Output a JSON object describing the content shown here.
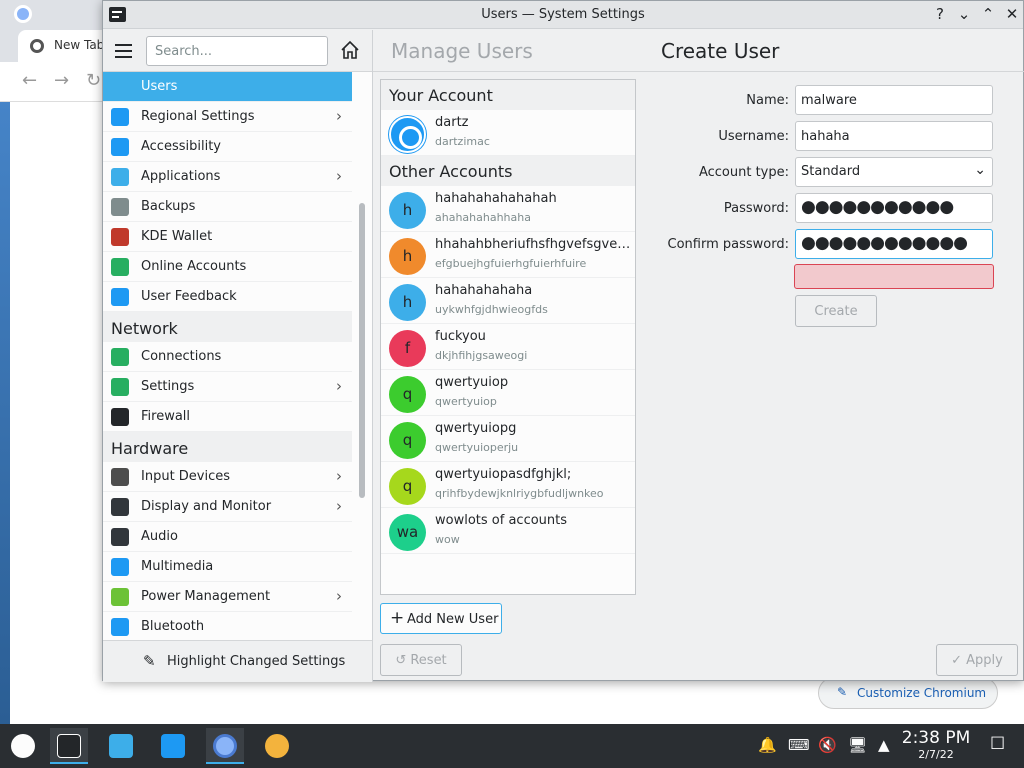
{
  "window": {
    "title": "Users — System Settings"
  },
  "sidebar": {
    "search_placeholder": "Search...",
    "items": [
      {
        "label": "Users",
        "icon": "users-icon",
        "color": "#3daee9",
        "selected": true,
        "chevron": false
      },
      {
        "label": "Regional Settings",
        "icon": "regional-settings-icon",
        "color": "#1d99f3",
        "chevron": true
      },
      {
        "label": "Accessibility",
        "icon": "accessibility-icon",
        "color": "#1d99f3",
        "chevron": false
      },
      {
        "label": "Applications",
        "icon": "applications-icon",
        "color": "#3daee9",
        "chevron": true
      },
      {
        "label": "Backups",
        "icon": "backups-icon",
        "color": "#7f8c8d",
        "chevron": false
      },
      {
        "label": "KDE Wallet",
        "icon": "kde-wallet-icon",
        "color": "#c0392b",
        "chevron": false
      },
      {
        "label": "Online Accounts",
        "icon": "online-accounts-icon",
        "color": "#27ae60",
        "chevron": false
      },
      {
        "label": "User Feedback",
        "icon": "user-feedback-icon",
        "color": "#1d99f3",
        "chevron": false
      }
    ],
    "section_network": "Network",
    "network_items": [
      {
        "label": "Connections",
        "icon": "connections-icon",
        "color": "#27ae60",
        "chevron": false
      },
      {
        "label": "Settings",
        "icon": "network-settings-icon",
        "color": "#27ae60",
        "chevron": true
      },
      {
        "label": "Firewall",
        "icon": "firewall-icon",
        "color": "#232629",
        "chevron": false
      }
    ],
    "section_hardware": "Hardware",
    "hardware_items": [
      {
        "label": "Input Devices",
        "icon": "input-devices-icon",
        "color": "#4d4d4d",
        "chevron": true
      },
      {
        "label": "Display and Monitor",
        "icon": "display-monitor-icon",
        "color": "#31363b",
        "chevron": true
      },
      {
        "label": "Audio",
        "icon": "audio-icon",
        "color": "#31363b",
        "chevron": false
      },
      {
        "label": "Multimedia",
        "icon": "multimedia-icon",
        "color": "#1d99f3",
        "chevron": false
      },
      {
        "label": "Power Management",
        "icon": "power-management-icon",
        "color": "#6cc236",
        "chevron": true
      },
      {
        "label": "Bluetooth",
        "icon": "bluetooth-icon",
        "color": "#1d99f3",
        "chevron": false
      }
    ],
    "footer_label": "Highlight Changed Settings"
  },
  "header": {
    "breadcrumb_prev": "Manage Users",
    "breadcrumb_current": "Create User"
  },
  "accounts": {
    "your_account_heading": "Your Account",
    "me": {
      "name": "dartz",
      "sub": "dartzimac"
    },
    "other_heading": "Other Accounts",
    "others": [
      {
        "initial": "h",
        "name": "hahahahahahahah",
        "sub": "ahahahahahhaha",
        "color": "#3daee9"
      },
      {
        "initial": "h",
        "name": "hhahahbheriufhsfhgvefsgveh...",
        "sub": "efgbuejhgfuierhgfuierhfuire",
        "color": "#f08a2c"
      },
      {
        "initial": "h",
        "name": "hahahahahaha",
        "sub": "uykwhfgjdhwieogfds",
        "color": "#3daee9"
      },
      {
        "initial": "f",
        "name": "fuckyou",
        "sub": "dkjhfihjgsaweogi",
        "color": "#e93a5a"
      },
      {
        "initial": "q",
        "name": "qwertyuiop",
        "sub": "qwertyuiop",
        "color": "#3ccc2e"
      },
      {
        "initial": "q",
        "name": "qwertyuiopg",
        "sub": "qwertyuioperju",
        "color": "#3ccc2e"
      },
      {
        "initial": "q",
        "name": "qwertyuiopasdfghjkl;",
        "sub": "qrihfbydewjknlriygbfudljwnkeo",
        "color": "#a6d81c"
      },
      {
        "initial": "wa",
        "name": "wowlots of accounts",
        "sub": "wow",
        "color": "#1dcf8b"
      }
    ],
    "add_button": "Add New User"
  },
  "form": {
    "name_label": "Name:",
    "name_value": "malware",
    "username_label": "Username:",
    "username_value": "hahaha",
    "type_label": "Account type:",
    "type_value": "Standard",
    "password_label": "Password:",
    "password_value": "●●●●●●●●●●●",
    "confirm_label": "Confirm password:",
    "confirm_value": "●●●●●●●●●●●●",
    "create_button": "Create"
  },
  "footer": {
    "reset_button": "Reset",
    "apply_button": "Apply"
  },
  "background": {
    "tab_label": "New Tab",
    "customize_label": "Customize Chromium"
  },
  "taskbar": {
    "time": "2:38 PM",
    "date": "2/7/22"
  }
}
